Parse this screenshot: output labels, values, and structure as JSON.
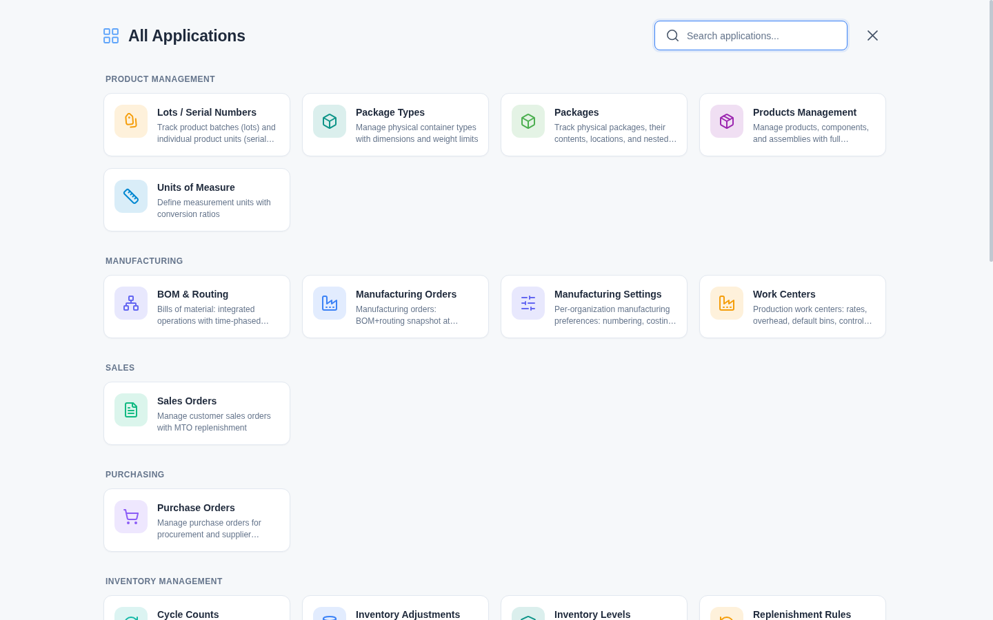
{
  "header": {
    "title": "All Applications",
    "search": {
      "placeholder": "Search applications..."
    }
  },
  "sections": [
    {
      "title": "PRODUCT MANAGEMENT",
      "apps": [
        {
          "name": "Lots / Serial Numbers",
          "description": "Track product batches (lots) and individual product units (serial…",
          "color": "#f59e0b"
        },
        {
          "name": "Package Types",
          "description": "Manage physical container types with dimensions and weight limits",
          "color": "#0d9488"
        },
        {
          "name": "Packages",
          "description": "Track physical packages, their contents, locations, and nested…",
          "color": "#4caf50"
        },
        {
          "name": "Products Management",
          "description": "Manage products, components, and assemblies with full…",
          "color": "#9c27b0"
        },
        {
          "name": "Units of Measure",
          "description": "Define measurement units with conversion ratios",
          "color": "#0288d1"
        }
      ]
    },
    {
      "title": "MANUFACTURING",
      "apps": [
        {
          "name": "BOM & Routing",
          "description": "Bills of material: integrated operations with time-phased…",
          "color": "#6366f1"
        },
        {
          "name": "Manufacturing Orders",
          "description": "Manufacturing orders: BOM+routing snapshot at…",
          "color": "#3b82f6"
        },
        {
          "name": "Manufacturing Settings",
          "description": "Per-organization manufacturing preferences: numbering, costin…",
          "color": "#6366f1"
        },
        {
          "name": "Work Centers",
          "description": "Production work centers: rates, overhead, default bins, control…",
          "color": "#f59e0b"
        }
      ]
    },
    {
      "title": "SALES",
      "apps": [
        {
          "name": "Sales Orders",
          "description": "Manage customer sales orders with MTO replenishment",
          "color": "#10b981"
        }
      ]
    },
    {
      "title": "PURCHASING",
      "apps": [
        {
          "name": "Purchase Orders",
          "description": "Manage purchase orders for procurement and supplier…",
          "color": "#8b5cf6"
        }
      ]
    },
    {
      "title": "INVENTORY MANAGEMENT",
      "apps": [
        {
          "name": "Cycle Counts",
          "color": "#14b8a6"
        },
        {
          "name": "Inventory Adjustments",
          "color": "#3b82f6"
        },
        {
          "name": "Inventory Levels",
          "color": "#0d9488"
        },
        {
          "name": "Replenishment Rules",
          "color": "#f59e0b"
        }
      ]
    }
  ]
}
